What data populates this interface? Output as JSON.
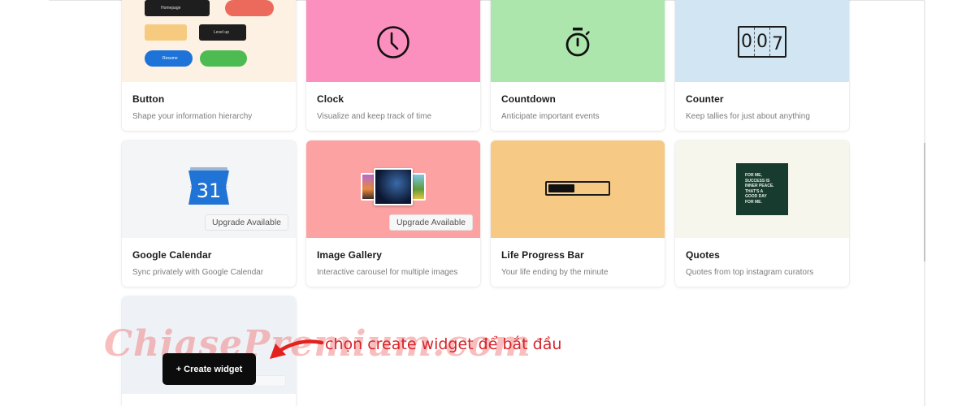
{
  "widgets": [
    {
      "title": "Button",
      "description": "Shape your information hierarchy",
      "preview_color": "#fdf1e3",
      "icon": "buttons-preview-icon"
    },
    {
      "title": "Clock",
      "description": "Visualize and keep track of time",
      "preview_color": "#fb8fbe",
      "icon": "clock-icon"
    },
    {
      "title": "Countdown",
      "description": "Anticipate important events",
      "preview_color": "#ade6ac",
      "icon": "stopwatch-icon"
    },
    {
      "title": "Counter",
      "description": "Keep tallies for just about anything",
      "preview_color": "#d1e5f2",
      "icon": "counter-icon",
      "counter_value": "007"
    },
    {
      "title": "Google Calendar",
      "description": "Sync privately with Google Calendar",
      "preview_color": "#f4f5f7",
      "icon": "calendar-icon",
      "calendar_day": "31",
      "badge": "Upgrade Available"
    },
    {
      "title": "Image Gallery",
      "description": "Interactive carousel for multiple images",
      "preview_color": "#fda2a2",
      "icon": "gallery-icon",
      "badge": "Upgrade Available"
    },
    {
      "title": "Life Progress Bar",
      "description": "Your life ending by the minute",
      "preview_color": "#f6ca84",
      "icon": "progress-bar-icon",
      "progress": 0.45
    },
    {
      "title": "Quotes",
      "description": "Quotes from top instagram curators",
      "preview_color": "#f6f6ec",
      "icon": "quote-icon",
      "quote_text": [
        "FOR ME,",
        "SUCCESS IS",
        "INNER PEACE.",
        "THAT'S A",
        "GOOD DAY",
        "FOR ME."
      ]
    }
  ],
  "button_preview_labels": [
    "Homepage",
    "Level up",
    "Resume"
  ],
  "create_widget": {
    "label": "+ Create widget",
    "preview_color": "#eef2f6"
  },
  "annotation": {
    "text": "chọn create widget để bắt đầu",
    "watermark": "ChiasePremium.com"
  }
}
